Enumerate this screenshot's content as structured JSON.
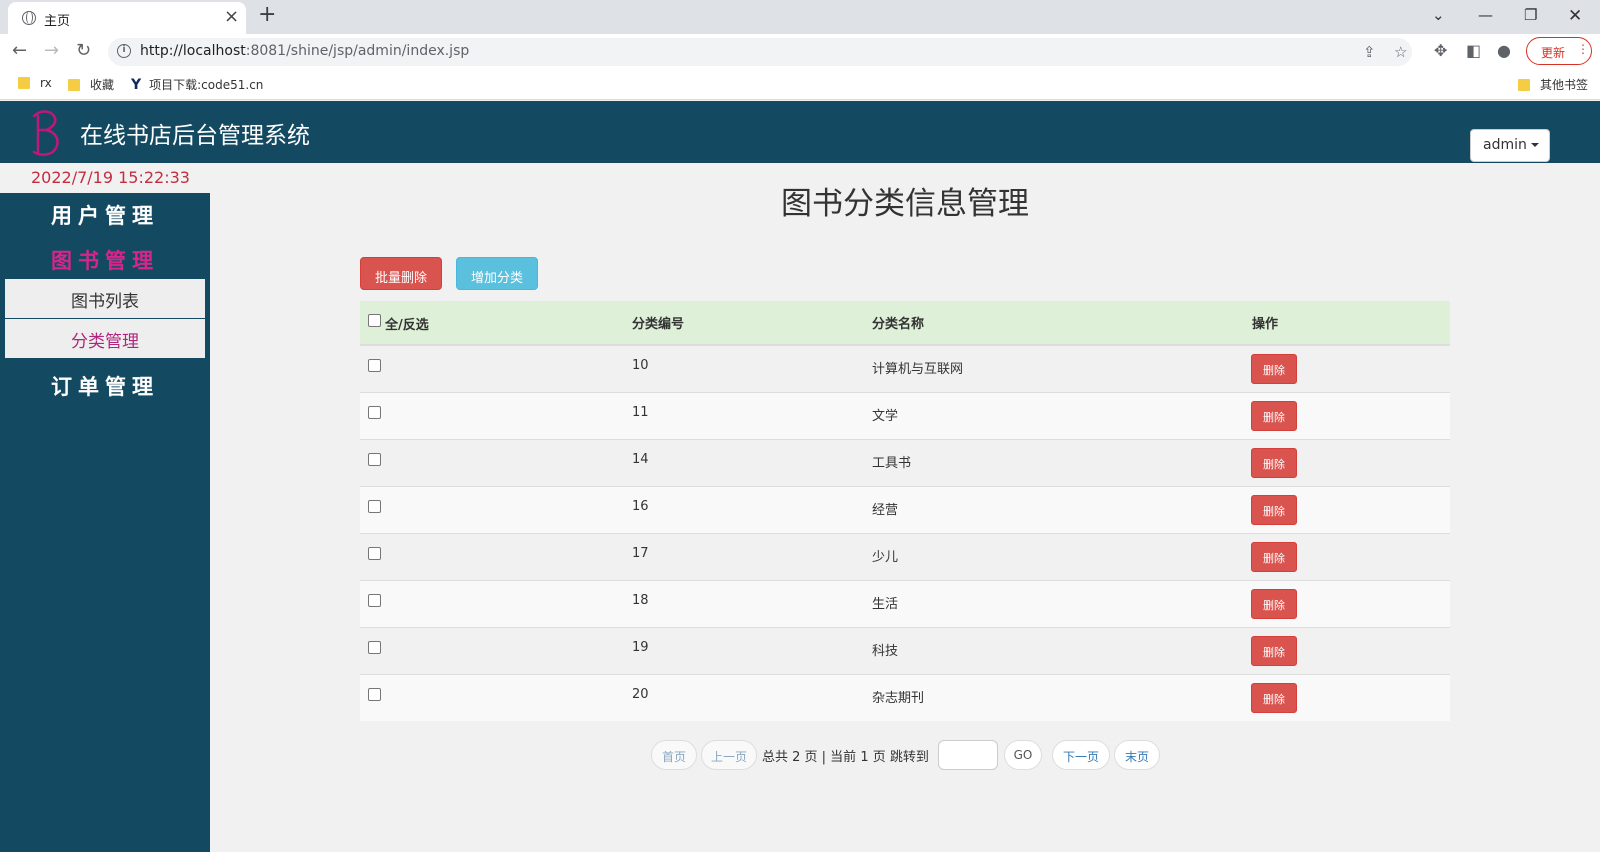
{
  "browser": {
    "tab_title": "主页",
    "url_host": "http://localhost",
    "url_rest": ":8081/shine/jsp/admin/index.jsp",
    "update_label": "更新",
    "bookmarks": [
      "rx",
      "收藏",
      "项目下载:code51.cn"
    ],
    "other_bookmarks": "其他书签"
  },
  "header": {
    "title": "在线书店后台管理系统",
    "user": "admin"
  },
  "clock": "2022/7/19 15:22:33",
  "sidebar": {
    "sections": [
      "用户管理",
      "图书管理",
      "订单管理"
    ],
    "sub_items": [
      "图书列表",
      "分类管理"
    ],
    "active_section": "图书管理",
    "active_item": "分类管理",
    "accent_color": "#d6268a"
  },
  "main": {
    "title": "图书分类信息管理",
    "batch_delete": "批量删除",
    "add_category": "增加分类",
    "columns": [
      "全/反选",
      "分类编号",
      "分类名称",
      "操作"
    ],
    "rows": [
      {
        "id": "10",
        "name": "计算机与互联网",
        "action": "删除"
      },
      {
        "id": "11",
        "name": "文学",
        "action": "删除"
      },
      {
        "id": "14",
        "name": "工具书",
        "action": "删除"
      },
      {
        "id": "16",
        "name": "经营",
        "action": "删除"
      },
      {
        "id": "17",
        "name": "少儿",
        "action": "删除"
      },
      {
        "id": "18",
        "name": "生活",
        "action": "删除"
      },
      {
        "id": "19",
        "name": "科技",
        "action": "删除"
      },
      {
        "id": "20",
        "name": "杂志期刊",
        "action": "删除"
      }
    ]
  },
  "pager": {
    "first": "首页",
    "prev": "上一页",
    "info": "总共 2 页 | 当前 1 页 跳转到",
    "go": "GO",
    "next": "下一页",
    "last": "末页"
  }
}
